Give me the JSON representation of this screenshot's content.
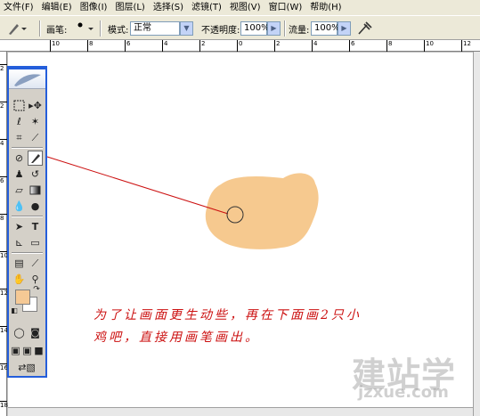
{
  "menu": [
    "文件(F)",
    "编辑(E)",
    "图像(I)",
    "图层(L)",
    "选择(S)",
    "滤镜(T)",
    "视图(V)",
    "窗口(W)",
    "帮助(H)"
  ],
  "options": {
    "brush_label": "画笔:",
    "brush_size": "9",
    "mode_label": "模式:",
    "mode_value": "正常",
    "opacity_label": "不透明度:",
    "opacity_value": "100%",
    "flow_label": "流量:",
    "flow_value": "100%"
  },
  "ruler": {
    "top_ticks": [
      "10",
      "8",
      "6",
      "4",
      "2",
      "0",
      "2",
      "4",
      "6",
      "8",
      "10",
      "12"
    ],
    "left_ticks": [
      "2",
      "2",
      "4",
      "6",
      "8",
      "10",
      "12",
      "14",
      "16",
      "18"
    ]
  },
  "colors": {
    "foreground": "#f5c995",
    "background": "#ffffff",
    "blob": "#f6c98f",
    "annotation": "#cc1111"
  },
  "annotation": {
    "line1": "为了让画面更生动些，再在下面画2只小",
    "line2": "鸡吧，直接用画笔画出。"
  },
  "watermark": {
    "main": "建站学",
    "sub": "jzxue.com"
  }
}
